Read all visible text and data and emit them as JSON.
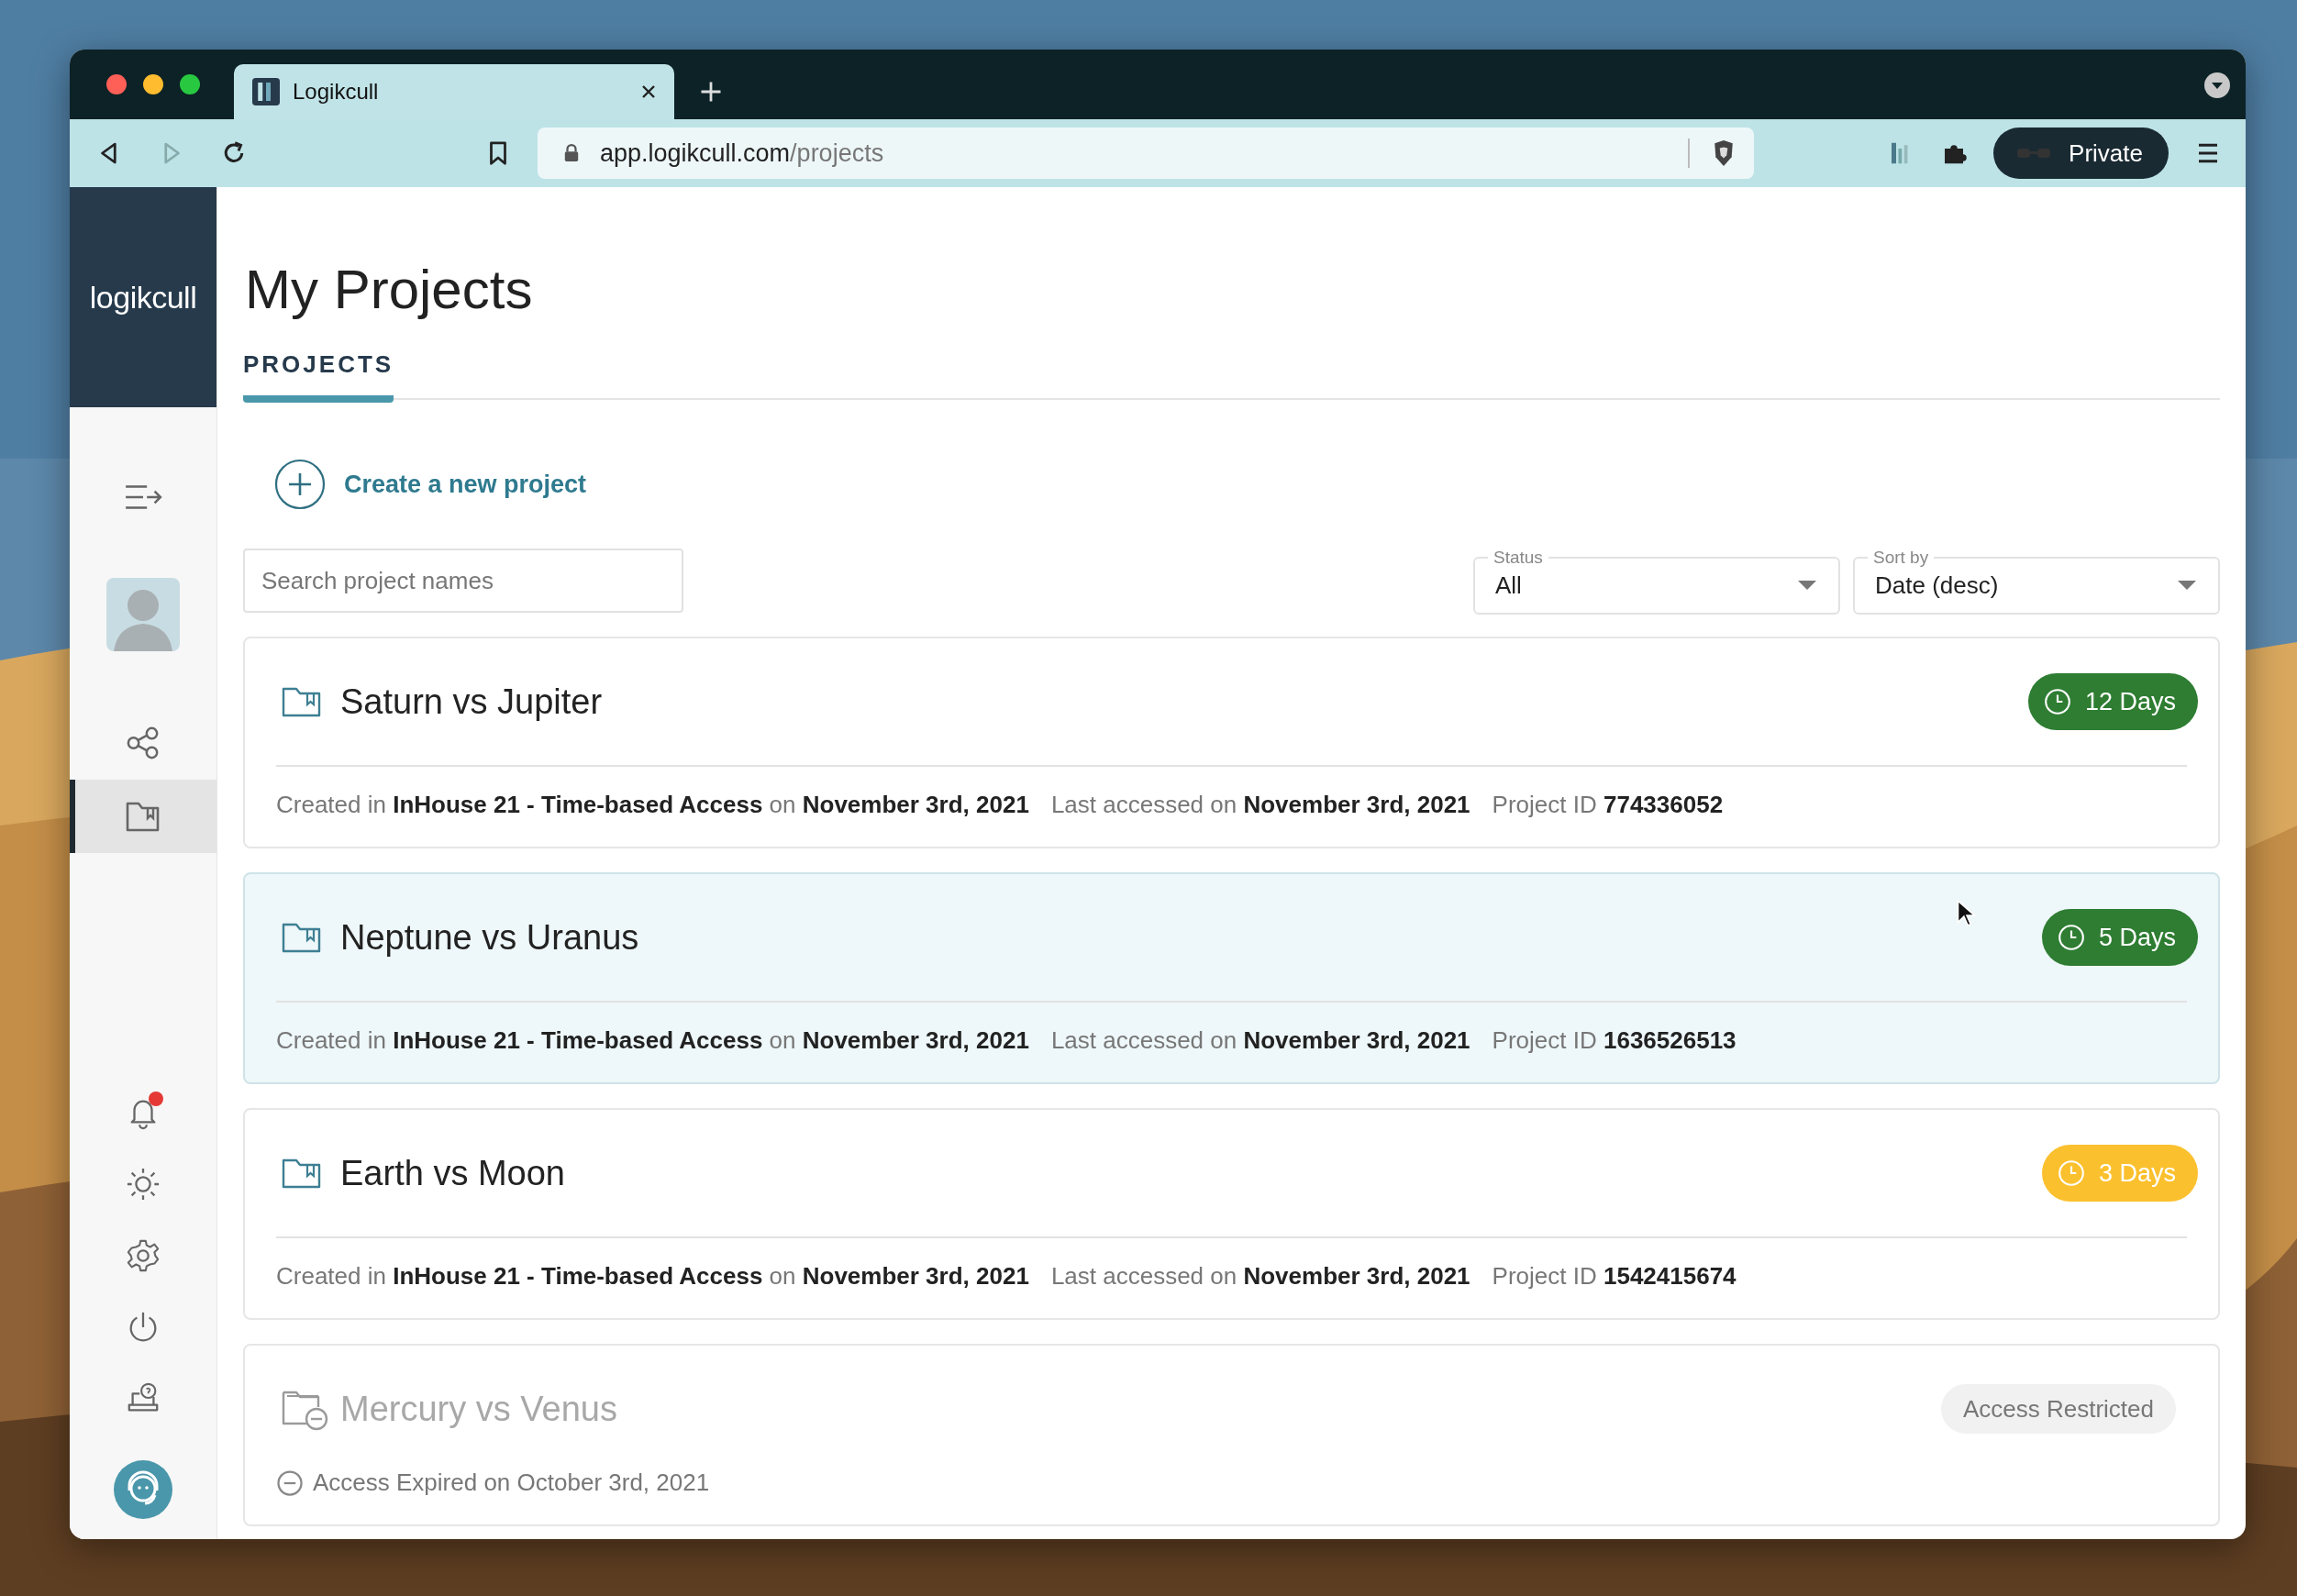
{
  "browser": {
    "tab_title": "Logikcull",
    "url_host": "app.logikcull.com",
    "url_path": "/projects",
    "private_label": "Private"
  },
  "sidebar": {
    "logo": "logikcull",
    "nav_items": [
      {
        "selected": false
      },
      {
        "selected": true
      }
    ],
    "unread_notifications": true
  },
  "page": {
    "title": "My Projects",
    "tabs": [
      {
        "label": "PROJECTS",
        "selected": true
      }
    ],
    "create_label": "Create a new project",
    "search": {
      "placeholder": "Search project names"
    },
    "filters": [
      {
        "label": "Status",
        "value": "All"
      },
      {
        "label": "Sort by",
        "value": "Date (desc)"
      }
    ]
  },
  "projects": [
    {
      "kind": "active",
      "name": "Saturn vs Jupiter",
      "highlighted": false,
      "badge": "12 Days",
      "color": "#2e7d32",
      "details": [
        "Created in **InHouse 21 - Time-based Access** on **November 3rd, 2021**",
        "Last accessed on **November 3rd, 2021**",
        "Project ID **774336052**"
      ]
    },
    {
      "kind": "active",
      "name": "Neptune vs Uranus",
      "highlighted": true,
      "badge": "5 Days",
      "color": "#2e7d32",
      "details": [
        "Created in **InHouse 21 - Time-based Access** on **November 3rd, 2021**",
        "Last accessed on **November 3rd, 2021**",
        "Project ID **1636526513**"
      ]
    },
    {
      "kind": "active",
      "name": "Earth vs Moon",
      "highlighted": false,
      "badge": "3 Days",
      "color": "#fbc02d",
      "details": [
        "Created in **InHouse 21 - Time-based Access** on **November 3rd, 2021**",
        "Last accessed on **November 3rd, 2021**",
        "Project ID **1542415674**"
      ]
    },
    {
      "kind": "restricted",
      "name": "Mercury vs Venus",
      "highlighted": false,
      "badge": "Access Restricted",
      "details": [
        "Access Expired on October 3rd, 2021"
      ]
    }
  ]
}
